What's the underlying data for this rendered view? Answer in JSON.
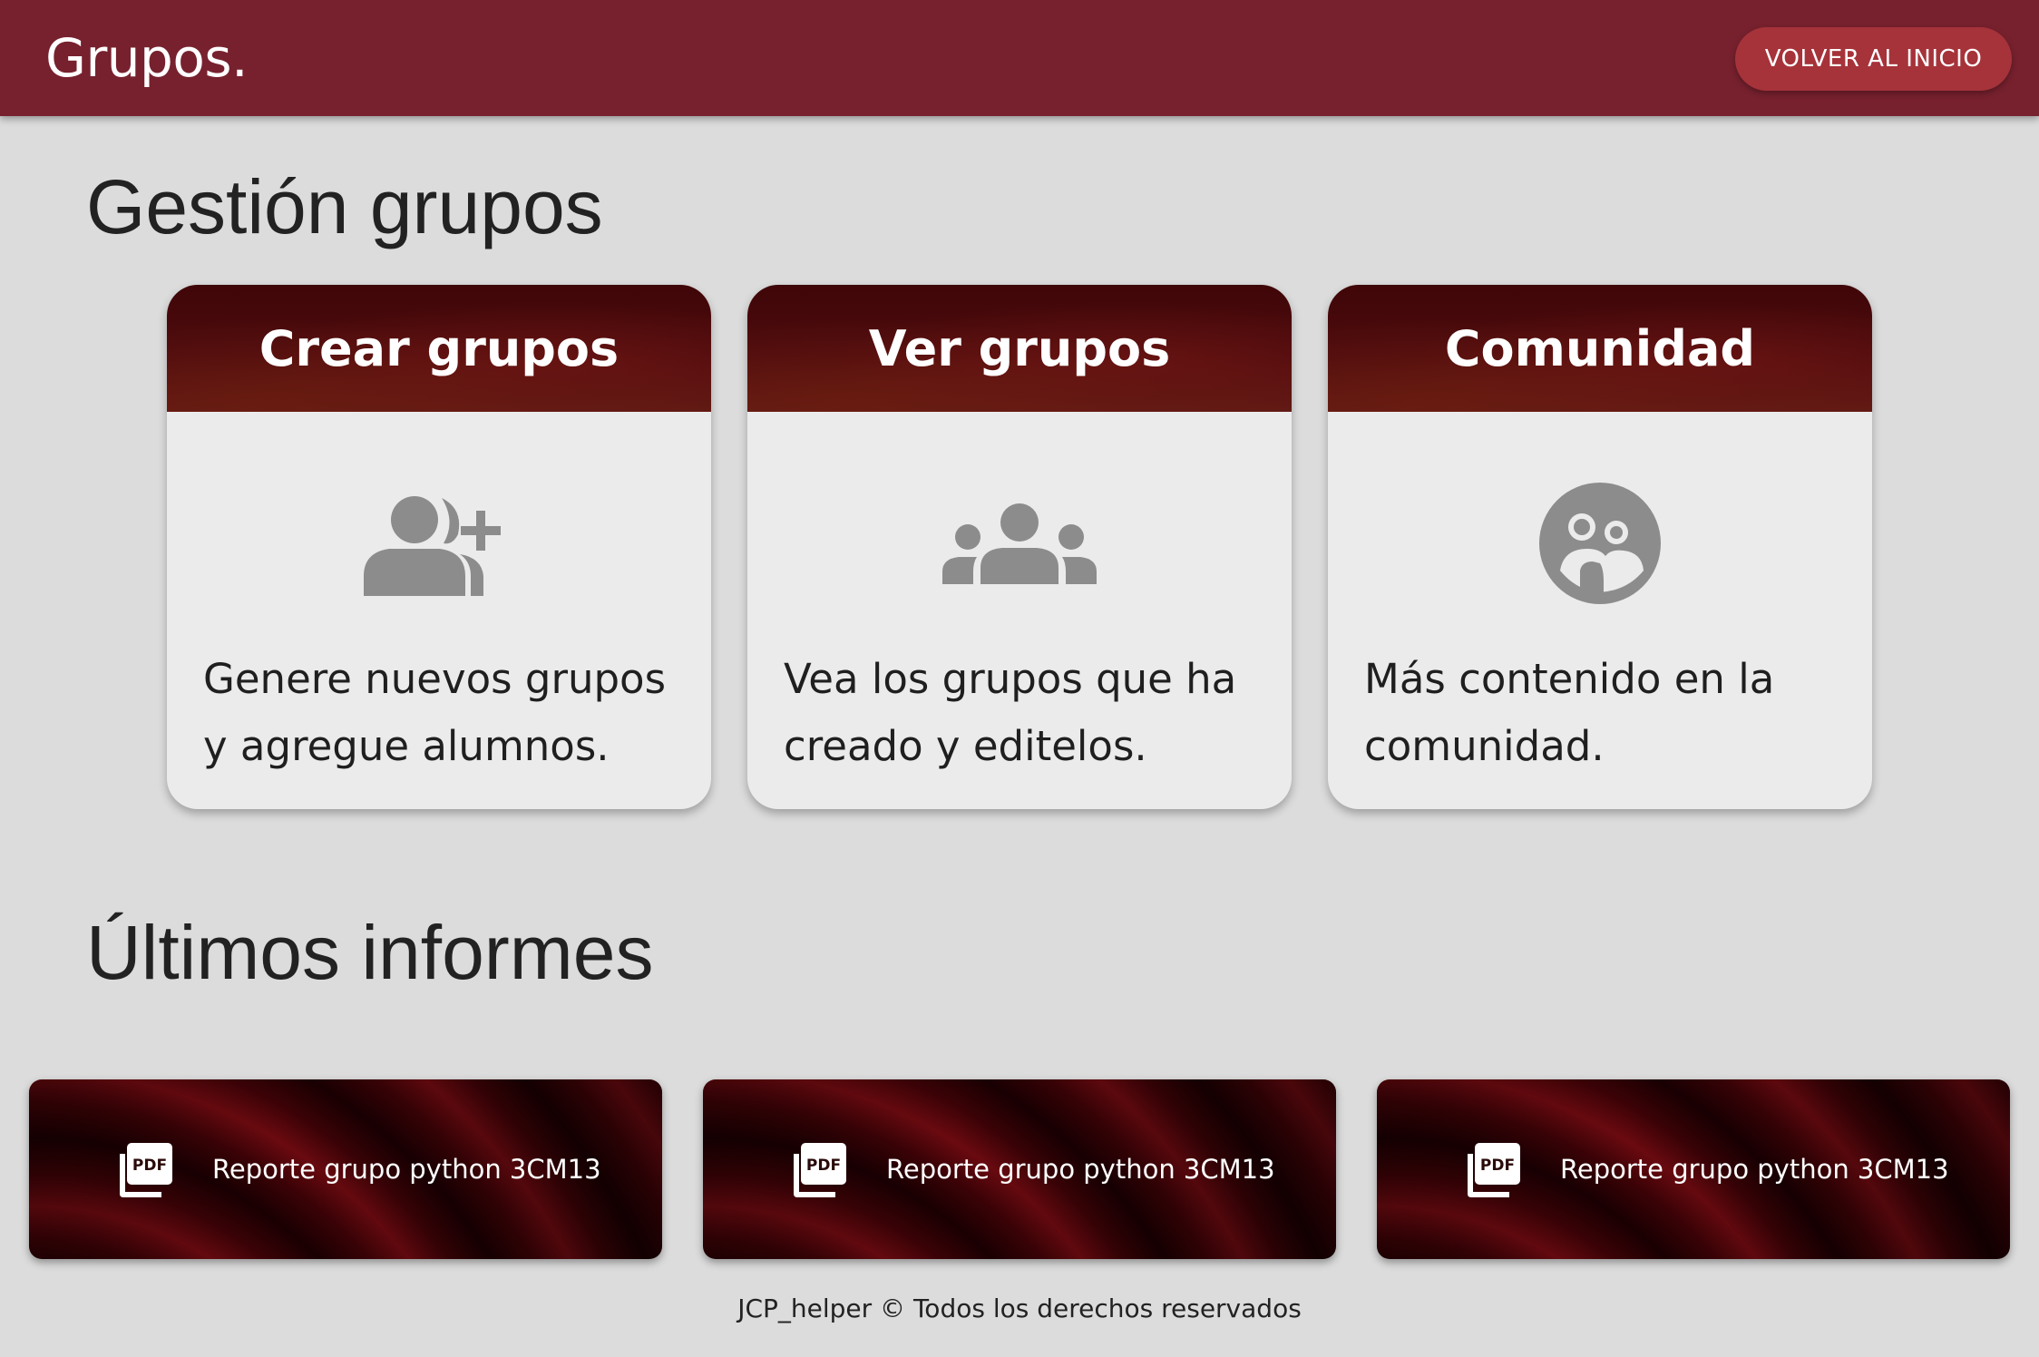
{
  "header": {
    "brand": "Grupos.",
    "home_button": "VOLVER AL INICIO"
  },
  "sections": {
    "management_title": "Gestión grupos",
    "reports_title": "Últimos informes"
  },
  "cards": [
    {
      "title": "Crear grupos",
      "icon": "add-group-icon",
      "description": "Genere nuevos grupos y agregue alumnos."
    },
    {
      "title": "Ver grupos",
      "icon": "groups-icon",
      "description": "Vea los grupos que ha creado y editelos."
    },
    {
      "title": "Comunidad",
      "icon": "community-icon",
      "description": "Más contenido en la comunidad."
    }
  ],
  "reports": [
    {
      "label": "Reporte grupo python 3CM13",
      "icon": "pdf-icon"
    },
    {
      "label": "Reporte grupo python 3CM13",
      "icon": "pdf-icon"
    },
    {
      "label": "Reporte grupo python 3CM13",
      "icon": "pdf-icon"
    }
  ],
  "footer": {
    "text": "JCP_helper © Todos los derechos reservados"
  },
  "colors": {
    "header_bg": "#77212e",
    "button_bg": "#a6333a",
    "page_bg": "#dcdcdc",
    "card_bg": "#ebebeb",
    "icon_gray": "#8c8c8c"
  }
}
